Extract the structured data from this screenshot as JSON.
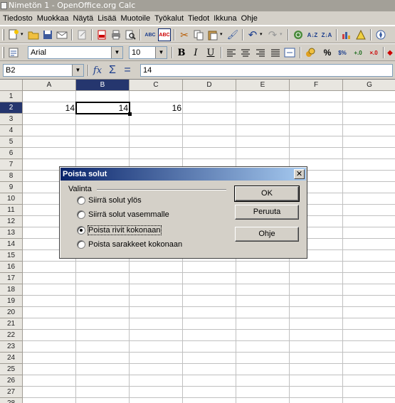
{
  "window": {
    "title": "Nimetön 1 - OpenOffice.org Calc"
  },
  "menu": [
    "Tiedosto",
    "Muokkaa",
    "Näytä",
    "Lisää",
    "Muotoile",
    "Työkalut",
    "Tiedot",
    "Ikkuna",
    "Ohje"
  ],
  "format_bar": {
    "font_name": "Arial",
    "font_size": "10",
    "bold": "B",
    "italic": "I",
    "underline": "U",
    "percent": "%",
    "currency": "$%"
  },
  "formula_bar": {
    "name_box": "B2",
    "content": "14"
  },
  "sheet": {
    "columns": [
      "A",
      "B",
      "C",
      "D",
      "E",
      "F",
      "G"
    ],
    "rows": [
      "1",
      "2",
      "3",
      "4",
      "5",
      "6",
      "7",
      "8",
      "9",
      "10",
      "11",
      "12",
      "13",
      "14",
      "15",
      "16",
      "17",
      "18",
      "19",
      "20",
      "21",
      "22",
      "23",
      "24",
      "25",
      "26",
      "27",
      "28"
    ],
    "selected_column": "B",
    "selected_row": "2",
    "cells": {
      "A2": "14",
      "B2": "14",
      "C2": "16"
    }
  },
  "dialog": {
    "title": "Poista solut",
    "close": "✕",
    "group_label": "Valinta",
    "options": [
      {
        "label": "Siirrä solut ylös",
        "selected": false
      },
      {
        "label": "Siirrä solut vasemmalle",
        "selected": false
      },
      {
        "label": "Poista rivit kokonaan",
        "selected": true
      },
      {
        "label": "Poista sarakkeet kokonaan",
        "selected": false
      }
    ],
    "buttons": {
      "ok": "OK",
      "cancel": "Peruuta",
      "help": "Ohje"
    }
  }
}
